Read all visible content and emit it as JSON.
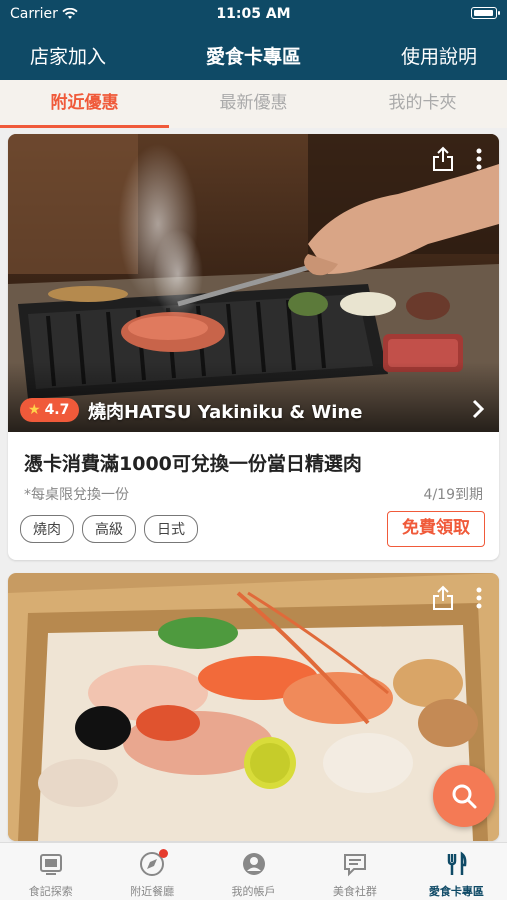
{
  "status": {
    "carrier": "Carrier",
    "time": "11:05 AM"
  },
  "nav": {
    "left": "店家加入",
    "title": "愛食卡專區",
    "right": "使用說明"
  },
  "tabs": [
    {
      "label": "附近優惠",
      "active": true
    },
    {
      "label": "最新優惠",
      "active": false
    },
    {
      "label": "我的卡夾",
      "active": false
    }
  ],
  "cards": [
    {
      "rating": "4.7",
      "store": "燒肉HATSU Yakiniku & Wine",
      "offer": "憑卡消費滿1000可兌換一份當日精選肉",
      "note": "*每桌限兌換一份",
      "expiry": "4/19到期",
      "tags": [
        "燒肉",
        "高級",
        "日式"
      ],
      "claim": "免費領取"
    }
  ],
  "tabbar": [
    {
      "label": "食記探索",
      "icon": "journal-icon"
    },
    {
      "label": "附近餐廳",
      "icon": "compass-icon",
      "badge": true
    },
    {
      "label": "我的帳戶",
      "icon": "account-icon"
    },
    {
      "label": "美食社群",
      "icon": "chat-icon"
    },
    {
      "label": "愛食卡專區",
      "icon": "fork-knife-icon",
      "active": true
    }
  ],
  "colors": {
    "nav_bg": "#0f4a66",
    "accent": "#f05a3a",
    "fab": "#f47a55"
  }
}
